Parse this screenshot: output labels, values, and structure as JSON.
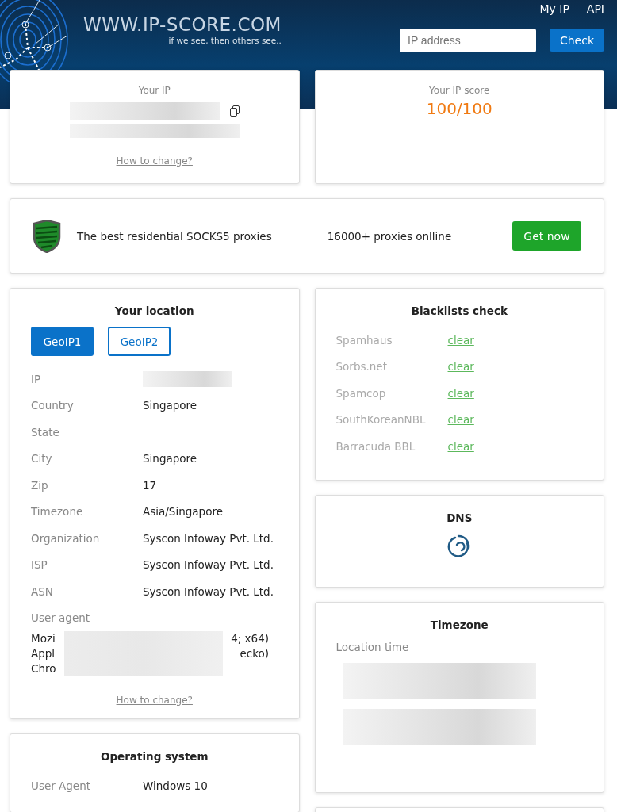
{
  "header": {
    "logo": "WWW.IP-SCORE.COM",
    "tagline": "if we see, then others see..",
    "nav": [
      "My IP",
      "API"
    ],
    "search": {
      "placeholder": "IP address"
    },
    "check_button": "Check"
  },
  "ip_card": {
    "title": "Your IP",
    "link": "How to change?"
  },
  "score_card": {
    "title": "Your IP score",
    "score": "100/100"
  },
  "banner": {
    "text": "The best residential SOCKS5 proxies",
    "count": "16000+ proxies onlline",
    "button": "Get now"
  },
  "location": {
    "title": "Your location",
    "tabs": [
      {
        "label": "GeoIP1",
        "selected": true
      },
      {
        "label": "GeoIP2",
        "selected": false
      }
    ],
    "rows": [
      {
        "label": "IP"
      },
      {
        "label": "Country",
        "value": "Singapore"
      },
      {
        "label": "State"
      },
      {
        "label": "City",
        "value": "Singapore"
      },
      {
        "label": "Zip",
        "value": "17"
      },
      {
        "label": "Timezone",
        "value": "Asia/Singapore"
      },
      {
        "label": "Organization",
        "value": "Syscon Infoway Pvt. Ltd."
      },
      {
        "label": "ISP",
        "value": "Syscon Infoway Pvt. Ltd."
      },
      {
        "label": "ASN",
        "value": "Syscon Infoway Pvt. Ltd."
      }
    ],
    "user_agent_label": "User agent",
    "user_agent_lines": [
      {
        "start": "Mozi",
        "end": "4; x64)"
      },
      {
        "start": "Appl",
        "end": "ecko)"
      },
      {
        "start": "Chro"
      }
    ],
    "link": "How to change?"
  },
  "os": {
    "title": "Operating system",
    "rows": [
      {
        "label": "User Agent",
        "value": "Windows 10"
      }
    ]
  },
  "blacklists": {
    "title": "Blacklists check",
    "items": [
      {
        "name": "Spamhaus",
        "status": "clear"
      },
      {
        "name": "Sorbs.net",
        "status": "clear"
      },
      {
        "name": "Spamcop",
        "status": "clear"
      },
      {
        "name": "SouthKoreanNBL",
        "status": "clear"
      },
      {
        "name": "Barracuda BBL",
        "status": "clear"
      }
    ]
  },
  "dns": {
    "title": "DNS"
  },
  "timezone": {
    "title": "Timezone",
    "label": "Location time"
  }
}
